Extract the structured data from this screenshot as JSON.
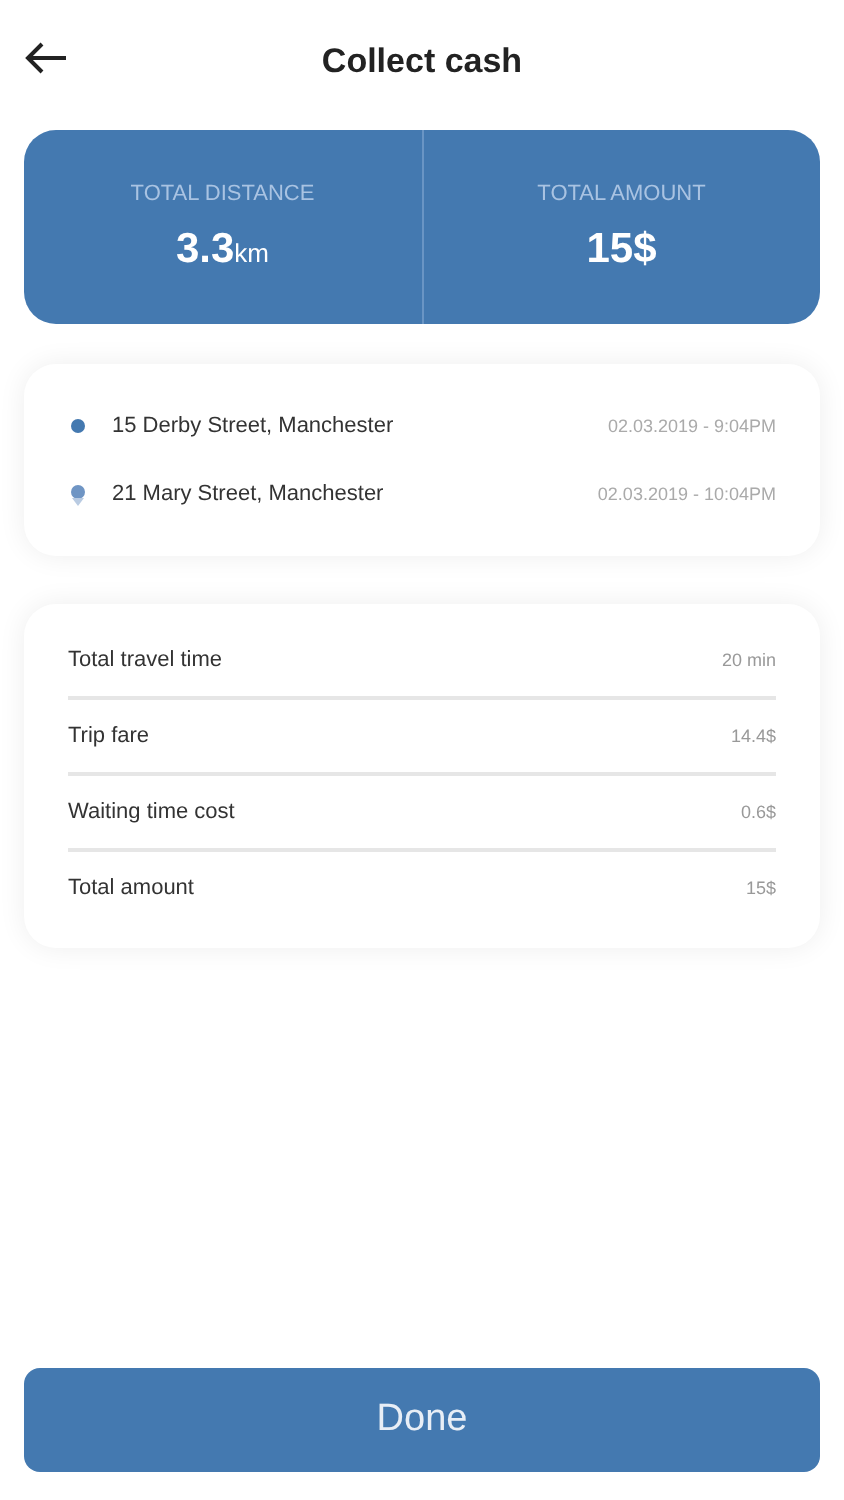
{
  "header": {
    "title": "Collect cash"
  },
  "summary": [
    {
      "label": "TOTAL DISTANCE",
      "value": "3.3",
      "unit": "km"
    },
    {
      "label": "TOTAL AMOUNT",
      "value": "15$"
    }
  ],
  "route": [
    {
      "address": "15 Derby Street, Manchester",
      "time": "02.03.2019 - 9:04PM",
      "kind": "pickup"
    },
    {
      "address": "21 Mary Street, Manchester",
      "time": "02.03.2019 - 10:04PM",
      "kind": "dropoff"
    }
  ],
  "details": [
    {
      "label": "Total travel time",
      "value": "20 min"
    },
    {
      "label": "Trip fare",
      "value": "14.4$"
    },
    {
      "label": "Waiting time cost",
      "value": "0.6$"
    },
    {
      "label": "Total amount",
      "value": "15$"
    }
  ],
  "done_button": "Done"
}
